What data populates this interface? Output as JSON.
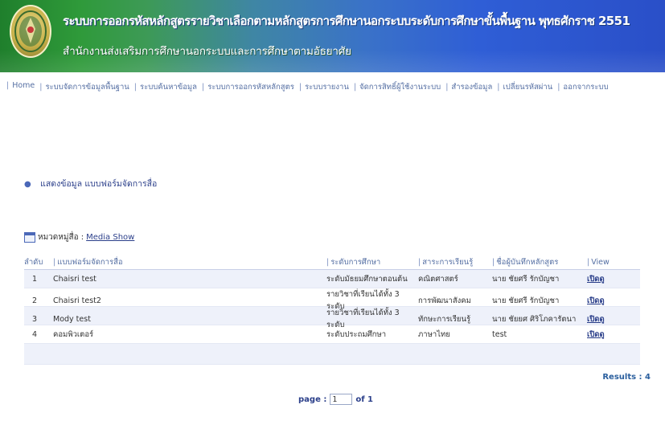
{
  "header": {
    "title_main": "ระบบการออกรหัสหลักสูตรรายวิชาเลือกตามหลักสูตรการศึกษานอกระบบระดับการศึกษาขั้นพื้นฐาน พุทธศักราช 2551",
    "title_sub": "สำนักงานส่งเสริมการศึกษานอกระบบและการศึกษาตามอัธยาศัย",
    "seal_icon": "office-seal-icon"
  },
  "nav": {
    "items": [
      "Home",
      "ระบบจัดการข้อมูลพื้นฐาน",
      "ระบบค้นหาข้อมูล",
      "ระบบการออกรหัสหลักสูตร",
      "ระบบรายงาน",
      "จัดการสิทธิ์ผู้ใช้งานระบบ",
      "สำรองข้อมูล",
      "เปลี่ยนรหัสผ่าน",
      "ออกจากระบบ"
    ]
  },
  "section": {
    "title": "แสดงข้อมูล แบบฟอร์มจัดการสื่อ"
  },
  "category": {
    "label": "หมวดหมู่สื่อ :",
    "value": "Media Show"
  },
  "table": {
    "headers": [
      "ลำดับ",
      "แบบฟอร์มจัดการสื่อ",
      "ระดับการศึกษา",
      "สาระการเรียนรู้",
      "ชื่อผู้บันทึกหลักสูตร",
      "View"
    ],
    "rows": [
      {
        "no": "1",
        "name": "Chaisri test",
        "level": "ระดับมัธยมศึกษาตอนต้น",
        "subject": "คณิตศาสตร์",
        "author": "นาย ชัยศรี รักบัญชา",
        "view": "เปิดดู"
      },
      {
        "no": "2",
        "name": "Chaisri test2",
        "level": "รายวิชาที่เรียนได้ทั้ง 3 ระดับ",
        "subject": "การพัฒนาสังคม",
        "author": "นาย ชัยศรี รักบัญชา",
        "view": "เปิดดู"
      },
      {
        "no": "3",
        "name": "Mody test",
        "level": "รายวิชาที่เรียนได้ทั้ง 3 ระดับ",
        "subject": "ทักษะการเรียนรู้",
        "author": "นาย ชัยยศ ศิริโภคารัตนา",
        "view": "เปิดดู"
      },
      {
        "no": "4",
        "name": "คอมพิวเตอร์",
        "level": "ระดับประถมศึกษา",
        "subject": "ภาษาไทย",
        "author": "test",
        "view": "เปิดดู"
      }
    ]
  },
  "results": {
    "label": "Results : 4"
  },
  "pager": {
    "label": "page :",
    "value": "1",
    "total": "of 1"
  }
}
